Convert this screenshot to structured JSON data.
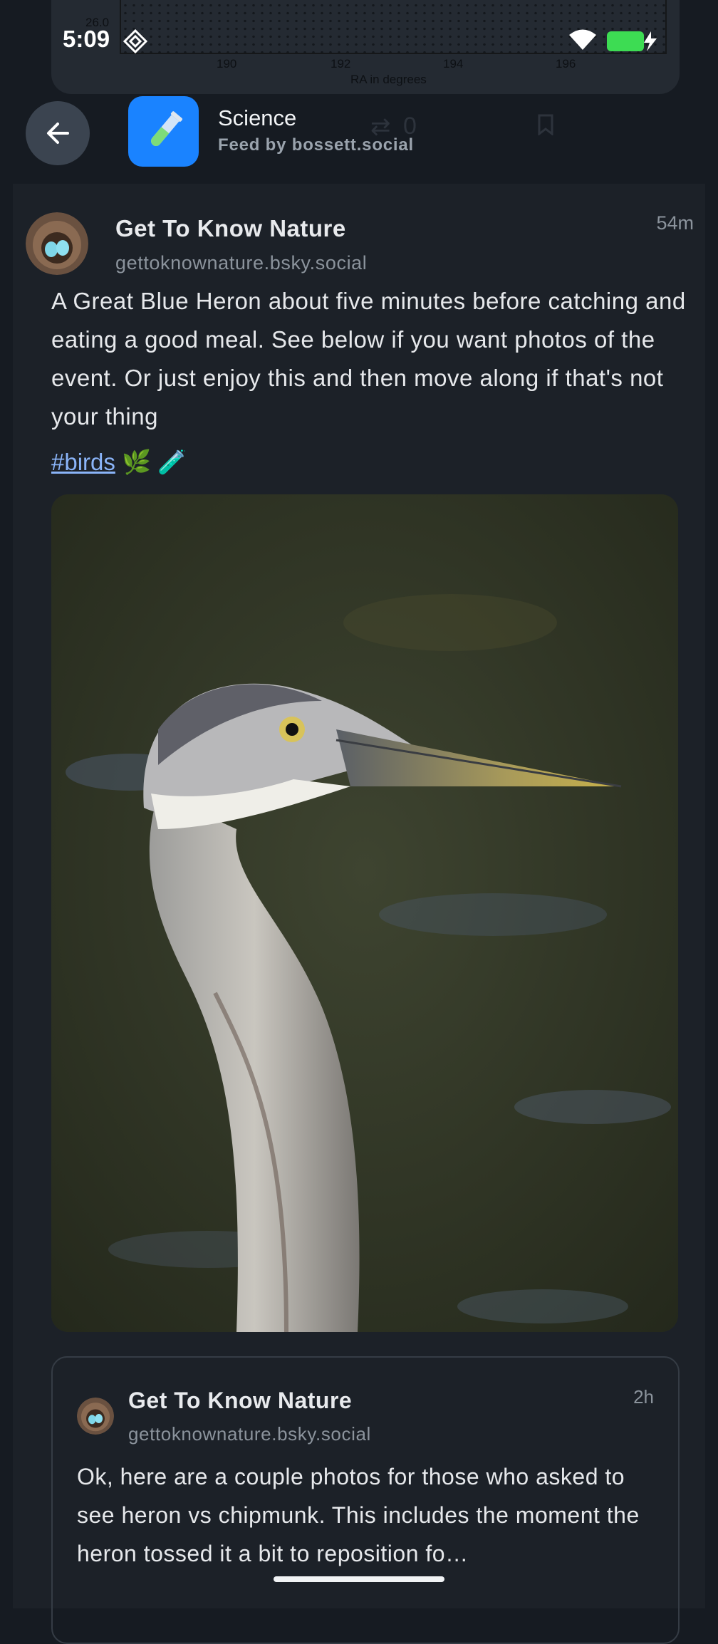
{
  "status_bar": {
    "time": "5:09",
    "icons": [
      "assistant-icon",
      "wifi-icon",
      "battery-charging-icon"
    ],
    "battery_color": "#3ddc53"
  },
  "previous_post_plot": {
    "y_tick": "26.0",
    "x_ticks": [
      "190",
      "192",
      "194",
      "196"
    ],
    "x_label": "RA in degrees",
    "ghost_counts": {
      "reposts": "0"
    }
  },
  "header": {
    "feed_title": "Science",
    "feed_subtitle": "Feed by bossett.social",
    "feed_icon": "test-tube-icon",
    "back_icon": "arrow-left-icon"
  },
  "post": {
    "author": "Get To Know Nature",
    "handle": "gettoknownature.bsky.social",
    "time": "54m",
    "text": "A Great Blue Heron about five minutes before catching and eating a good meal. See below if you want photos of the event. Or just enjoy this and then move along if that's not your thing",
    "hashtag": "#birds",
    "emojis": "🌿 🧪",
    "image_icon": "heron-photo"
  },
  "quoted_post": {
    "author": "Get To Know Nature",
    "handle": "gettoknownature.bsky.social",
    "time": "2h",
    "text": "Ok, here are a couple photos for those who asked to see heron vs chipmunk. This includes the moment the heron tossed it a bit to reposition fo…"
  },
  "colors": {
    "background": "#161b22",
    "card": "#1c2128",
    "link": "#8ab4f8",
    "feed_icon_bg": "#1a83ff"
  }
}
